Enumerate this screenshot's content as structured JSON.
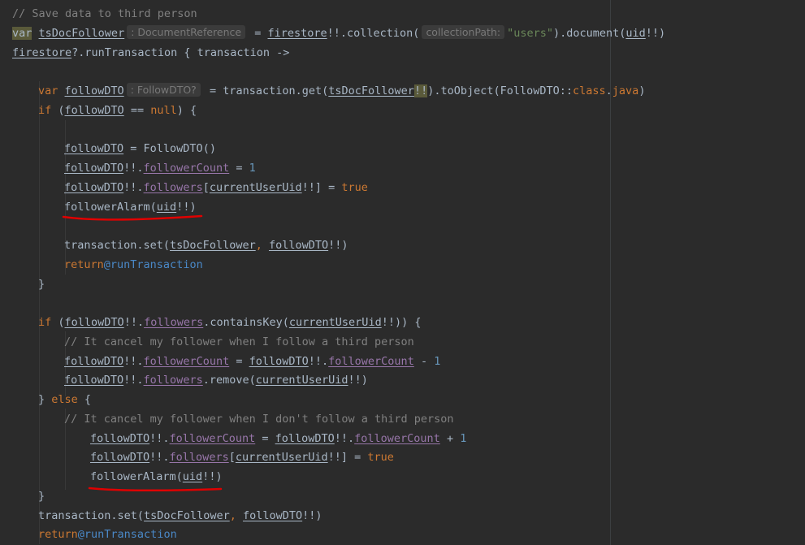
{
  "editor": {
    "lines": [
      {
        "indent": 0,
        "tokens": [
          {
            "t": "// Save data to third person",
            "c": "cmt"
          }
        ]
      },
      {
        "indent": 0,
        "tokens": [
          {
            "t": "var",
            "c": "hl"
          },
          {
            "t": " ",
            "c": "plain"
          },
          {
            "t": "tsDocFollower",
            "c": "var"
          },
          {
            "t": ": DocumentReference",
            "c": "hint"
          },
          {
            "t": " = ",
            "c": "plain"
          },
          {
            "t": "firestore",
            "c": "var"
          },
          {
            "t": "!!.collection(",
            "c": "plain"
          },
          {
            "t": "collectionPath:",
            "c": "hint"
          },
          {
            "t": "\"users\"",
            "c": "str"
          },
          {
            "t": ").document(",
            "c": "plain"
          },
          {
            "t": "uid",
            "c": "var"
          },
          {
            "t": "!!)",
            "c": "plain"
          }
        ]
      },
      {
        "indent": 0,
        "tokens": [
          {
            "t": "firestore",
            "c": "var"
          },
          {
            "t": "?.runTransaction { transaction ->",
            "c": "plain"
          }
        ]
      },
      {
        "indent": 0,
        "tokens": []
      },
      {
        "indent": 1,
        "tokens": [
          {
            "t": "var",
            "c": "kw"
          },
          {
            "t": " ",
            "c": "plain"
          },
          {
            "t": "followDTO",
            "c": "var"
          },
          {
            "t": ": FollowDTO?",
            "c": "hint"
          },
          {
            "t": " = transaction.get(",
            "c": "plain"
          },
          {
            "t": "tsDocFollower",
            "c": "var"
          },
          {
            "t": "!!",
            "c": "hl"
          },
          {
            "t": ").toObject(FollowDTO::",
            "c": "plain"
          },
          {
            "t": "class",
            "c": "kw"
          },
          {
            "t": ".",
            "c": "plain"
          },
          {
            "t": "java",
            "c": "kw"
          },
          {
            "t": ")",
            "c": "plain"
          }
        ]
      },
      {
        "indent": 1,
        "tokens": [
          {
            "t": "if",
            "c": "kw"
          },
          {
            "t": " (",
            "c": "plain"
          },
          {
            "t": "followDTO",
            "c": "var"
          },
          {
            "t": " == ",
            "c": "plain"
          },
          {
            "t": "null",
            "c": "kw"
          },
          {
            "t": ") {",
            "c": "plain"
          }
        ]
      },
      {
        "indent": 0,
        "tokens": []
      },
      {
        "indent": 2,
        "tokens": [
          {
            "t": "followDTO",
            "c": "var"
          },
          {
            "t": " = FollowDTO()",
            "c": "plain"
          }
        ]
      },
      {
        "indent": 2,
        "tokens": [
          {
            "t": "followDTO",
            "c": "var"
          },
          {
            "t": "!!.",
            "c": "plain"
          },
          {
            "t": "followerCount",
            "c": "field"
          },
          {
            "t": " = ",
            "c": "plain"
          },
          {
            "t": "1",
            "c": "num"
          }
        ]
      },
      {
        "indent": 2,
        "tokens": [
          {
            "t": "followDTO",
            "c": "var"
          },
          {
            "t": "!!.",
            "c": "plain"
          },
          {
            "t": "followers",
            "c": "field"
          },
          {
            "t": "[",
            "c": "plain"
          },
          {
            "t": "currentUserUid",
            "c": "var"
          },
          {
            "t": "!!] = ",
            "c": "plain"
          },
          {
            "t": "true",
            "c": "kw"
          }
        ]
      },
      {
        "indent": 2,
        "tokens": [
          {
            "t": "followerAlarm(",
            "c": "plain"
          },
          {
            "t": "uid",
            "c": "var"
          },
          {
            "t": "!!)",
            "c": "plain"
          }
        ]
      },
      {
        "indent": 0,
        "tokens": []
      },
      {
        "indent": 2,
        "tokens": [
          {
            "t": "transaction.set(",
            "c": "plain"
          },
          {
            "t": "tsDocFollower",
            "c": "var"
          },
          {
            "t": ", ",
            "c": "kw"
          },
          {
            "t": "followDTO",
            "c": "var"
          },
          {
            "t": "!!)",
            "c": "plain"
          }
        ]
      },
      {
        "indent": 2,
        "tokens": [
          {
            "t": "return",
            "c": "kw"
          },
          {
            "t": "@runTransaction",
            "c": "label"
          }
        ]
      },
      {
        "indent": 1,
        "tokens": [
          {
            "t": "}",
            "c": "plain"
          }
        ]
      },
      {
        "indent": 0,
        "tokens": []
      },
      {
        "indent": 1,
        "tokens": [
          {
            "t": "if",
            "c": "kw"
          },
          {
            "t": " (",
            "c": "plain"
          },
          {
            "t": "followDTO",
            "c": "var"
          },
          {
            "t": "!!.",
            "c": "plain"
          },
          {
            "t": "followers",
            "c": "field"
          },
          {
            "t": ".containsKey(",
            "c": "plain"
          },
          {
            "t": "currentUserUid",
            "c": "var"
          },
          {
            "t": "!!)) {",
            "c": "plain"
          }
        ]
      },
      {
        "indent": 2,
        "tokens": [
          {
            "t": "// It cancel my follower when I follow a third person",
            "c": "cmt"
          }
        ]
      },
      {
        "indent": 2,
        "tokens": [
          {
            "t": "followDTO",
            "c": "var"
          },
          {
            "t": "!!.",
            "c": "plain"
          },
          {
            "t": "followerCount",
            "c": "field"
          },
          {
            "t": " = ",
            "c": "plain"
          },
          {
            "t": "followDTO",
            "c": "var"
          },
          {
            "t": "!!.",
            "c": "plain"
          },
          {
            "t": "followerCount",
            "c": "field"
          },
          {
            "t": " - ",
            "c": "plain"
          },
          {
            "t": "1",
            "c": "num"
          }
        ]
      },
      {
        "indent": 2,
        "tokens": [
          {
            "t": "followDTO",
            "c": "var"
          },
          {
            "t": "!!.",
            "c": "plain"
          },
          {
            "t": "followers",
            "c": "field"
          },
          {
            "t": ".remove(",
            "c": "plain"
          },
          {
            "t": "currentUserUid",
            "c": "var"
          },
          {
            "t": "!!)",
            "c": "plain"
          }
        ]
      },
      {
        "indent": 1,
        "tokens": [
          {
            "t": "} ",
            "c": "plain"
          },
          {
            "t": "else",
            "c": "kw"
          },
          {
            "t": " {",
            "c": "plain"
          }
        ]
      },
      {
        "indent": 2,
        "tokens": [
          {
            "t": "// It cancel my follower when I don't follow a third person",
            "c": "cmt"
          }
        ]
      },
      {
        "indent": 3,
        "tokens": [
          {
            "t": "followDTO",
            "c": "var"
          },
          {
            "t": "!!.",
            "c": "plain"
          },
          {
            "t": "followerCount",
            "c": "field"
          },
          {
            "t": " = ",
            "c": "plain"
          },
          {
            "t": "followDTO",
            "c": "var"
          },
          {
            "t": "!!.",
            "c": "plain"
          },
          {
            "t": "followerCount",
            "c": "field"
          },
          {
            "t": " + ",
            "c": "plain"
          },
          {
            "t": "1",
            "c": "num"
          }
        ]
      },
      {
        "indent": 3,
        "tokens": [
          {
            "t": "followDTO",
            "c": "var"
          },
          {
            "t": "!!.",
            "c": "plain"
          },
          {
            "t": "followers",
            "c": "field"
          },
          {
            "t": "[",
            "c": "plain"
          },
          {
            "t": "currentUserUid",
            "c": "var"
          },
          {
            "t": "!!] = ",
            "c": "plain"
          },
          {
            "t": "true",
            "c": "kw"
          }
        ]
      },
      {
        "indent": 3,
        "tokens": [
          {
            "t": "followerAlarm(",
            "c": "plain"
          },
          {
            "t": "uid",
            "c": "var"
          },
          {
            "t": "!!)",
            "c": "plain"
          }
        ]
      },
      {
        "indent": 1,
        "tokens": [
          {
            "t": "}",
            "c": "plain"
          }
        ]
      },
      {
        "indent": 1,
        "tokens": [
          {
            "t": "transaction.set(",
            "c": "plain"
          },
          {
            "t": "tsDocFollower",
            "c": "var"
          },
          {
            "t": ", ",
            "c": "kw"
          },
          {
            "t": "followDTO",
            "c": "var"
          },
          {
            "t": "!!)",
            "c": "plain"
          }
        ]
      },
      {
        "indent": 1,
        "tokens": [
          {
            "t": "return",
            "c": "kw"
          },
          {
            "t": "@runTransaction",
            "c": "label"
          }
        ]
      }
    ]
  },
  "annotations": [
    {
      "name": "red-underline-first",
      "color": "#e00000"
    },
    {
      "name": "red-underline-second",
      "color": "#e00000"
    }
  ],
  "colors": {
    "background": "#2b2b2b",
    "keyword": "#cc7832",
    "string": "#6a8759",
    "number": "#6897bb",
    "comment": "#808080",
    "field": "#9876aa",
    "label": "#4a88c7",
    "annotation": "#e00000"
  }
}
